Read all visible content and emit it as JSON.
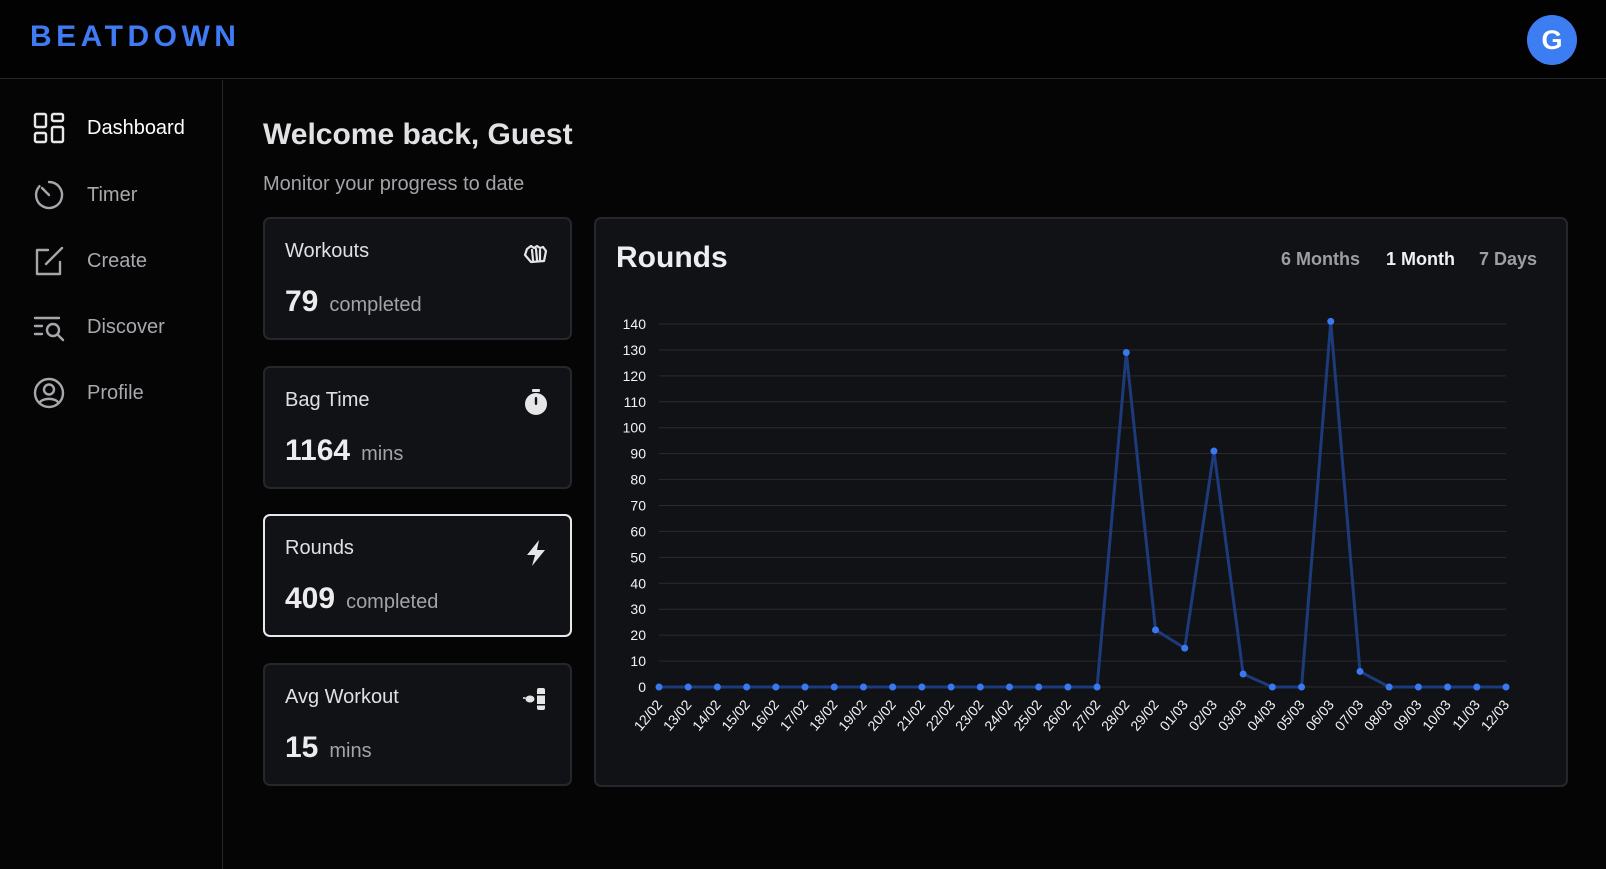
{
  "app": {
    "logo": "BEATDOWN",
    "avatar_initial": "G",
    "accent": "#3f7bf5"
  },
  "sidebar": {
    "items": [
      {
        "label": "Dashboard",
        "icon": "dashboard-grid-icon",
        "active": true
      },
      {
        "label": "Timer",
        "icon": "timer-icon",
        "active": false
      },
      {
        "label": "Create",
        "icon": "edit-square-icon",
        "active": false
      },
      {
        "label": "Discover",
        "icon": "search-list-icon",
        "active": false
      },
      {
        "label": "Profile",
        "icon": "user-circle-icon",
        "active": false
      }
    ]
  },
  "header": {
    "welcome": "Welcome back, Guest",
    "subtitle": "Monitor your progress to date"
  },
  "cards": [
    {
      "title": "Workouts",
      "value": "79",
      "unit": "completed",
      "icon": "fist-icon",
      "selected": false
    },
    {
      "title": "Bag Time",
      "value": "1164",
      "unit": "mins",
      "icon": "stopwatch-icon",
      "selected": false
    },
    {
      "title": "Rounds",
      "value": "409",
      "unit": "completed",
      "icon": "lightning-icon",
      "selected": true
    },
    {
      "title": "Avg Workout",
      "value": "15",
      "unit": "mins",
      "icon": "punching-bag-icon",
      "selected": false
    }
  ],
  "chart": {
    "title": "Rounds",
    "ranges": [
      {
        "label": "6 Months",
        "active": false
      },
      {
        "label": "1 Month",
        "active": true
      },
      {
        "label": "7 Days",
        "active": false
      }
    ]
  },
  "chart_data": {
    "type": "line",
    "title": "Rounds",
    "x": [
      "12/02",
      "13/02",
      "14/02",
      "15/02",
      "16/02",
      "17/02",
      "18/02",
      "19/02",
      "20/02",
      "21/02",
      "22/02",
      "23/02",
      "24/02",
      "25/02",
      "26/02",
      "27/02",
      "28/02",
      "29/02",
      "01/03",
      "02/03",
      "03/03",
      "04/03",
      "05/03",
      "06/03",
      "07/03",
      "08/03",
      "09/03",
      "10/03",
      "11/03",
      "12/03"
    ],
    "series": [
      {
        "values": [
          0,
          0,
          0,
          0,
          0,
          0,
          0,
          0,
          0,
          0,
          0,
          0,
          0,
          0,
          0,
          0,
          129,
          22,
          15,
          91,
          5,
          0,
          0,
          141,
          6,
          0,
          0,
          0,
          0,
          0
        ]
      }
    ],
    "ylim": [
      0,
      140
    ],
    "yticks": [
      0,
      10,
      20,
      30,
      40,
      50,
      60,
      70,
      80,
      90,
      100,
      110,
      120,
      130,
      140
    ],
    "grid": true,
    "line_color": "#1d3a7a",
    "point_color": "#3a78f2"
  }
}
